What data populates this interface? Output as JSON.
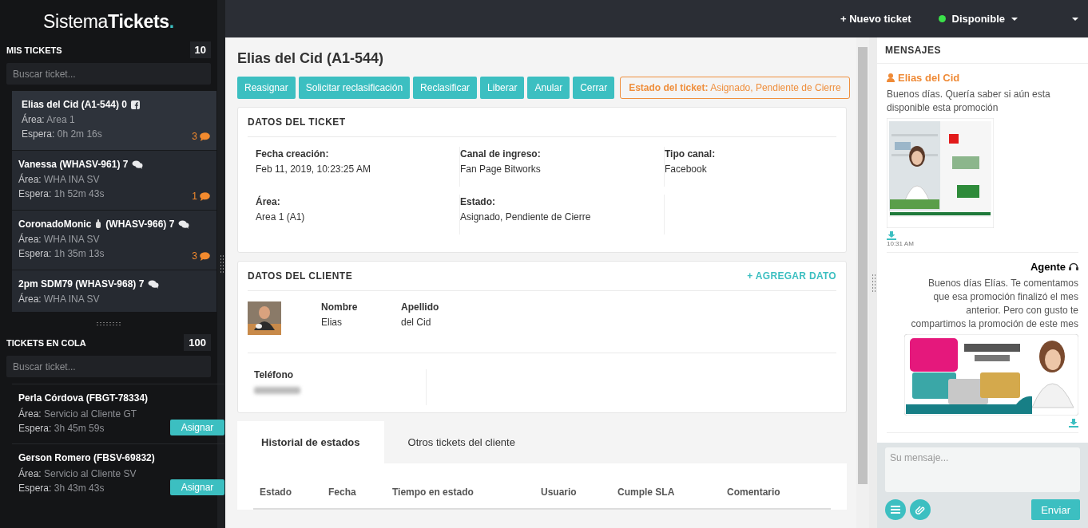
{
  "logo": {
    "light": "Sistema",
    "bold": "Tickets",
    "dot": "."
  },
  "topbar": {
    "new_ticket": "+ Nuevo ticket",
    "status": "Disponible",
    "online": true
  },
  "my_tickets": {
    "title": "MIS TICKETS",
    "count": "10",
    "search_placeholder": "Buscar ticket...",
    "items": [
      {
        "title": "Elias del Cid (A1-544) 0",
        "kind": "facebook",
        "area_label": "Área:",
        "area": "Area 1",
        "wait_label": "Espera:",
        "wait": "0h 2m 16s",
        "unread": "3",
        "selected": true
      },
      {
        "title": "Vanessa (WHASV-961) 7",
        "kind": "chat",
        "area_label": "Área:",
        "area": "WHA INA SV",
        "wait_label": "Espera:",
        "wait": "1h 52m 43s",
        "unread": "1",
        "selected": false
      },
      {
        "title": "CoronadoMonic",
        "title_rest": "(WHASV-966) 7",
        "kind": "chat",
        "area_label": "Área:",
        "area": "WHA INA SV",
        "wait_label": "Espera:",
        "wait": "1h 35m 13s",
        "unread": "3",
        "selected": false
      },
      {
        "title": "2pm SDM79 (WHASV-968) 7",
        "kind": "chat",
        "area_label": "Área:",
        "area": "WHA INA SV",
        "selected": false
      }
    ]
  },
  "queue": {
    "title": "TICKETS EN COLA",
    "count": "100",
    "search_placeholder": "Buscar ticket...",
    "items": [
      {
        "title": "Perla Córdova (FBGT-78334)",
        "area_label": "Área:",
        "area": "Servicio al Cliente GT",
        "wait_label": "Espera:",
        "wait": "3h 45m 59s",
        "button": "Asignar"
      },
      {
        "title": "Gerson Romero (FBSV-69832)",
        "area_label": "Área:",
        "area": "Servicio al Cliente SV",
        "wait_label": "Espera:",
        "wait": "3h 43m 43s",
        "button": "Asignar"
      }
    ]
  },
  "ticket": {
    "title": "Elias del Cid (A1-544)",
    "actions": [
      "Reasignar",
      "Solicitar reclasificación",
      "Reclasificar",
      "Liberar",
      "Anular",
      "Cerrar"
    ],
    "status_label": "Estado del ticket:",
    "status": "Asignado, Pendiente de Cierre",
    "details": {
      "title": "DATOS DEL TICKET",
      "fields": [
        {
          "label": "Fecha creación:",
          "value": "Feb 11, 2019, 10:23:25 AM"
        },
        {
          "label": "Canal de ingreso:",
          "value": "Fan Page Bitworks"
        },
        {
          "label": "Tipo canal:",
          "value": "Facebook"
        },
        {
          "label": "Área:",
          "value": "Area 1 (A1)"
        },
        {
          "label": "Estado:",
          "value": "Asignado, Pendiente de Cierre"
        }
      ]
    },
    "client": {
      "title": "DATOS DEL CLIENTE",
      "add_link": "+ AGREGAR DATO",
      "fields": [
        {
          "label": "Nombre",
          "value": "Elias"
        },
        {
          "label": "Apellido",
          "value": "del Cid"
        }
      ],
      "phone": {
        "label": "Teléfono",
        "redacted": true
      }
    },
    "tabs": [
      {
        "label": "Historial de estados",
        "selected": true
      },
      {
        "label": "Otros tickets del cliente",
        "selected": false
      }
    ],
    "table": {
      "columns": [
        "Estado",
        "Fecha",
        "Tiempo en estado",
        "Usuario",
        "Cumple SLA",
        "Comentario"
      ]
    }
  },
  "messages": {
    "title": "MENSAJES",
    "items": [
      {
        "kind": "customer",
        "author": "Elias del Cid",
        "text": "Buenos días. Quería saber si aún esta disponible esta promoción",
        "time": "10:31 AM"
      },
      {
        "kind": "agent",
        "author": "Agente",
        "text": "Buenos días Elías. Te comentamos que esa promoción finalizó el mes anterior. Pero con gusto te compartimos la promoción de este mes"
      }
    ],
    "composer_placeholder": "Su mensaje...",
    "send": "Enviar"
  }
}
